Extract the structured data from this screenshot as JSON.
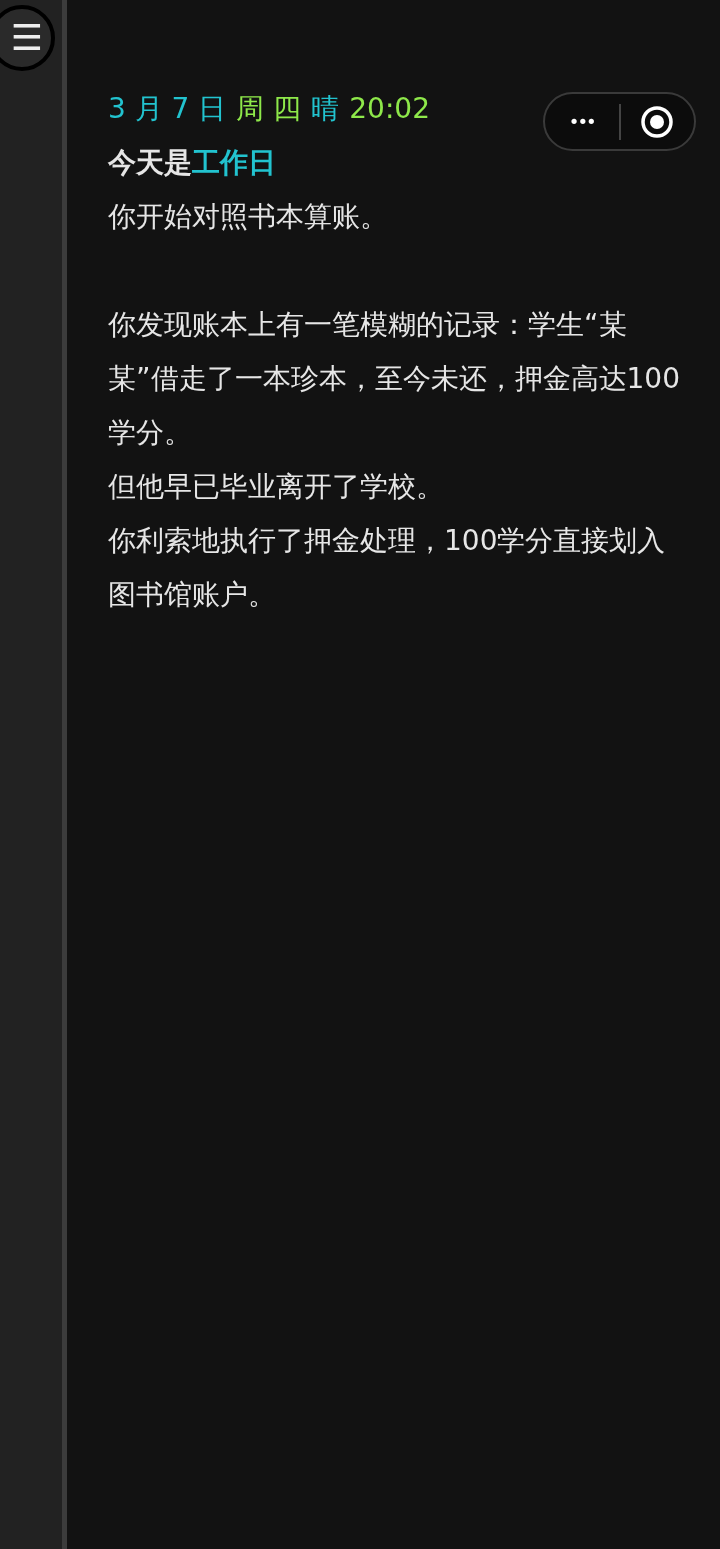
{
  "menu_button": {
    "icon": "☰"
  },
  "capsule": {
    "more": "•••"
  },
  "date_line": [
    {
      "text": "3 月 7 日",
      "color": "#22c3cf"
    },
    {
      "text": "周 四",
      "color": "#8ee84a"
    },
    {
      "text": "晴",
      "color": "#22c3cf"
    },
    {
      "text": "20:02",
      "color": "#8ee84a"
    }
  ],
  "title": [
    {
      "text": "今天是",
      "color": "#e6e6e6"
    },
    {
      "text": "工作日",
      "color": "#22c3cf"
    }
  ],
  "sections": [
    [
      "你开始对照书本算账。"
    ],
    [
      "你发现账本上有一笔模糊的记录：学生“某某”借走了一本珍本，至今未还，押金高达100学分。",
      "但他早已毕业离开了学校。",
      "你利索地执行了押金处理，100学分直接划入图书馆账户。"
    ]
  ]
}
